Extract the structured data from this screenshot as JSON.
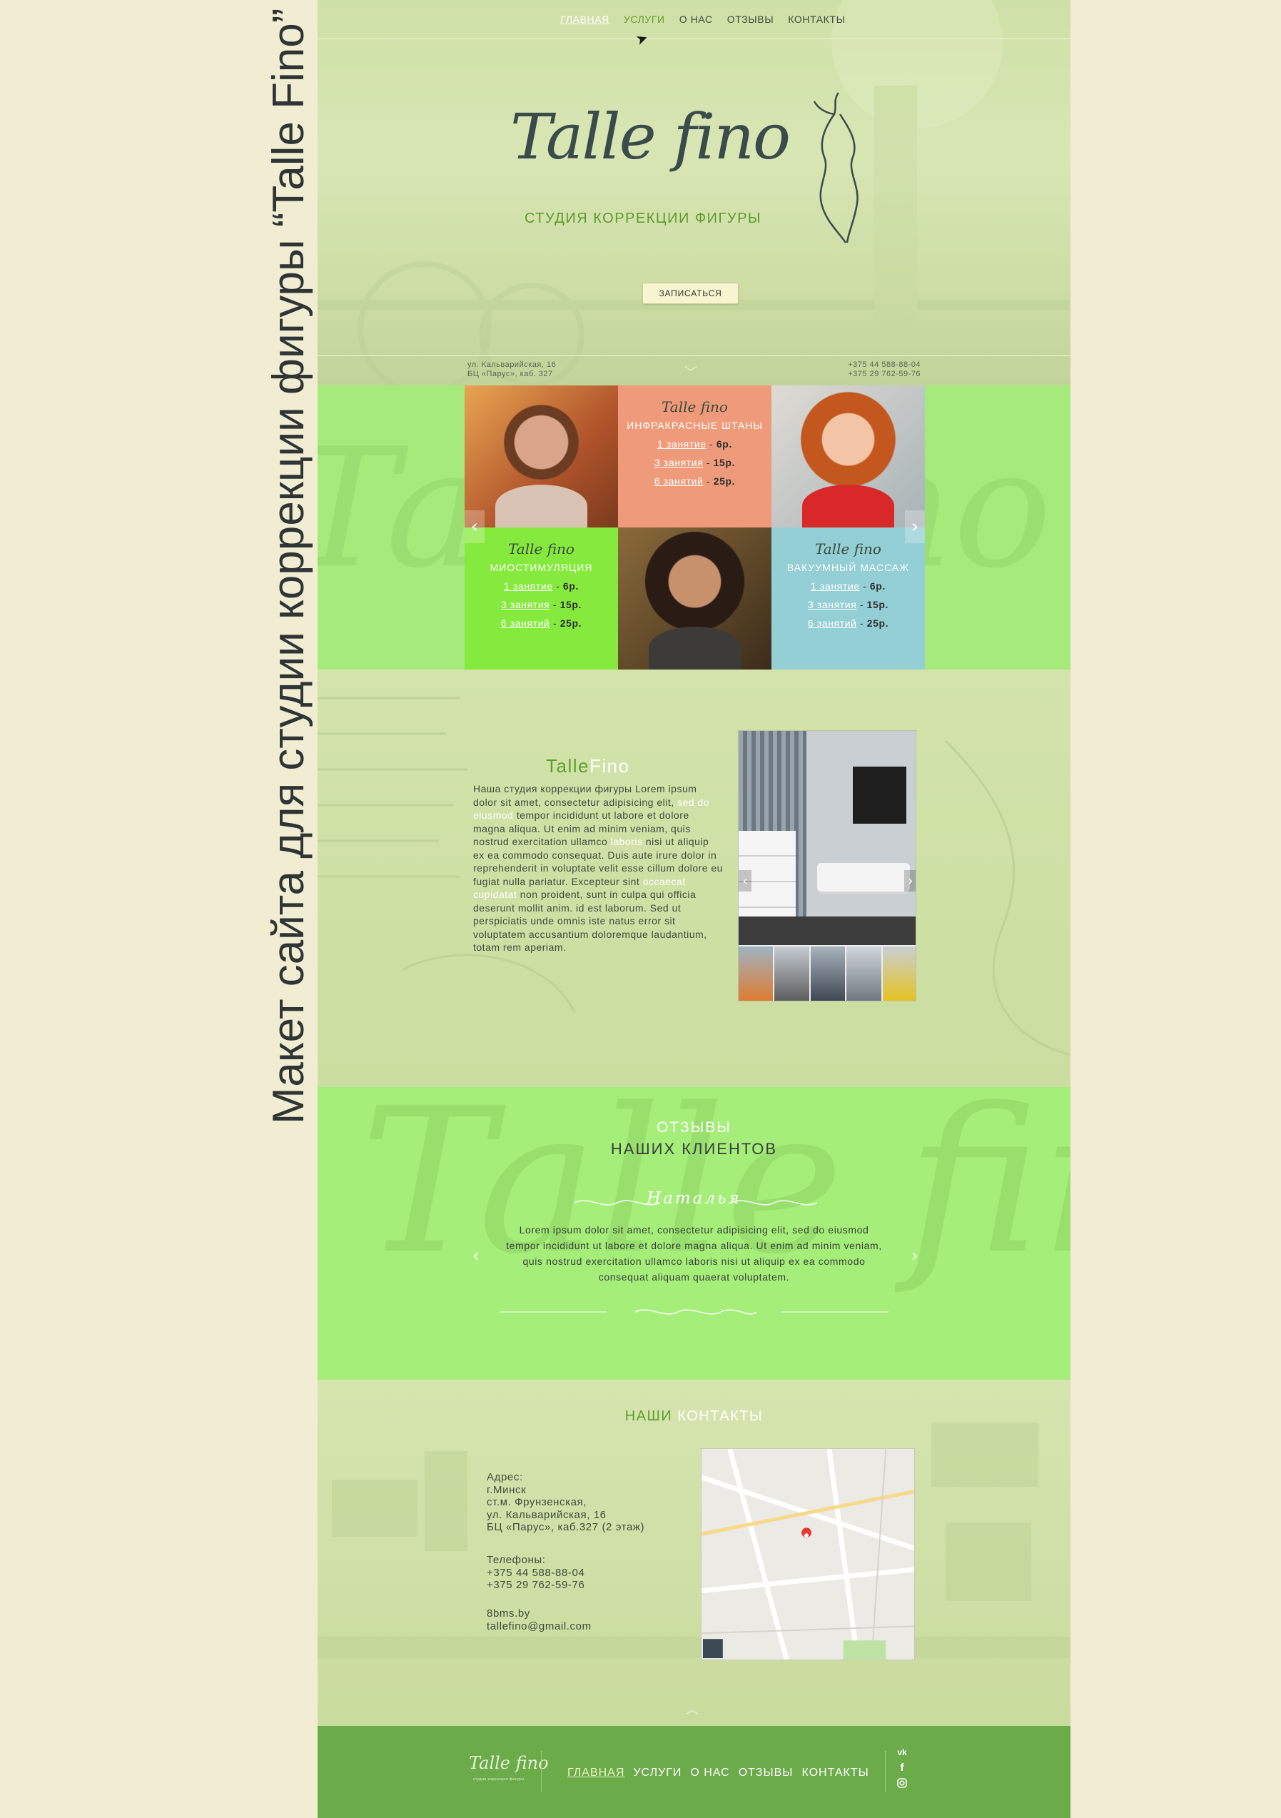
{
  "caption": "Макет сайта для студии коррекции фигуры “Talle Fino”",
  "nav": {
    "items": [
      {
        "label": "ГЛАВНАЯ"
      },
      {
        "label": "УСЛУГИ"
      },
      {
        "label": "О НАС"
      },
      {
        "label": "ОТЗЫВЫ"
      },
      {
        "label": "КОНТАКТЫ"
      }
    ]
  },
  "hero": {
    "logo": "Talle fino",
    "subtitle": "СТУДИЯ КОРРЕКЦИИ ФИГУРЫ",
    "cta": "ЗАПИСАТЬСЯ",
    "address_line1": "ул. Кальварийская, 16",
    "address_line2": "БЦ «Парус», каб. 327",
    "phone1": "+375 44 588-88-04",
    "phone2": "+375 29 762-59-76"
  },
  "services": {
    "mini_logo": "Talle fino",
    "cards": [
      {
        "title": "ИНФРАКРАСНЫЕ ШТАНЫ",
        "color": "#ef9b7b",
        "rows": [
          {
            "label": "1 занятие",
            "price": "6р."
          },
          {
            "label": "3 занятия",
            "price": "15р."
          },
          {
            "label": "6 занятий",
            "price": "25р."
          }
        ]
      },
      {
        "title": "МИОСТИМУЛЯЦИЯ",
        "color": "#86ea3e",
        "rows": [
          {
            "label": "1 занятие",
            "price": "6р."
          },
          {
            "label": "3 занятия",
            "price": "15р."
          },
          {
            "label": "6 занятий",
            "price": "25р."
          }
        ]
      },
      {
        "title": "ВАКУУМНЫЙ МАССАЖ",
        "color": "#95cfd6",
        "rows": [
          {
            "label": "1 занятие",
            "price": "6р."
          },
          {
            "label": "3 занятия",
            "price": "15р."
          },
          {
            "label": "6 занятий",
            "price": "25р."
          }
        ]
      }
    ]
  },
  "about": {
    "title_a": "Talle",
    "title_b": "Fino",
    "p1": "Наша студия коррекции фигуры Lorem ipsum dolor sit amet, consectetur adipisicing elit,",
    "p1_hl": "sed do eiusmod",
    "p2": "tempor incididunt ut labore et dolore magna aliqua. Ut enim ad minim veniam, quis nostrud exercitation ullamco",
    "p2_hl": "laboris",
    "p3": "nisi ut aliquip ex ea commodo consequat. Duis aute irure dolor in reprehenderit in voluptate velit esse cillum dolore eu fugiat nulla pariatur. Excepteur sint",
    "p3_hl": "occaecat cupidatat",
    "p4": "non proident, sunt in culpa qui officia deserunt mollit anim. id est laborum. Sed ut perspiciatis unde omnis iste natus error sit voluptatem accusantium doloremque laudantium, totam rem aperiam."
  },
  "reviews": {
    "title1": "ОТЗЫВЫ",
    "title2": "НАШИХ КЛИЕНТОВ",
    "name": "Наталья",
    "text": "Lorem ipsum dolor sit amet, consectetur adipisicing elit, sed do eiusmod tempor incididunt ut labore et dolore magna aliqua. Ut enim ad minim veniam, quis nostrud exercitation ullamco laboris nisi ut aliquip ex ea commodo consequat aliquam quaerat voluptatem."
  },
  "contacts": {
    "title_a": "НАШИ",
    "title_b": "КОНТАКТЫ",
    "address_label": "Адрес:",
    "address_1": "г.Минск",
    "address_2": "ст.м. Фрунзенская,",
    "address_3": "ул. Кальварийская, 16",
    "address_4": "БЦ «Парус», каб.327 (2 этаж)",
    "phones_label": "Телефоны:",
    "phone1": "+375 44 588-88-04",
    "phone2": "+375 29 762-59-76",
    "site": "8bms.by",
    "email": "tallefino@gmail.com"
  },
  "footer": {
    "logo": "Talle fino",
    "logo_sub": "студия коррекции фигуры",
    "nav": [
      "ГЛАВНАЯ",
      "УСЛУГИ",
      "О НАС",
      "ОТЗЫВЫ",
      "КОНТАКТЫ"
    ],
    "social": [
      "vk-icon",
      "facebook-icon",
      "instagram-icon"
    ]
  },
  "colors": {
    "accent_green": "#5ea02a",
    "footer_green": "#6bab4a",
    "reviews_green": "#a6ee7a",
    "services_orange": "#ef9b7b",
    "services_lime": "#86ea3e",
    "services_blue": "#95cfd6"
  }
}
